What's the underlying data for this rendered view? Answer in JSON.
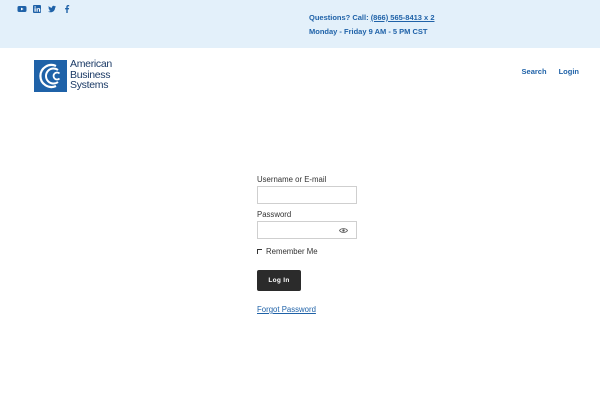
{
  "topbar": {
    "social": [
      "youtube-icon",
      "linkedin-icon",
      "twitter-icon",
      "facebook-icon"
    ],
    "questions_label": "Questions? Call:",
    "phone": "(866) 565-8413 x 2",
    "hours": "Monday - Friday 9 AM - 5 PM CST"
  },
  "logo": {
    "line1": "American",
    "line2": "Business",
    "line3": "Systems",
    "color": "#1f62a8"
  },
  "nav": {
    "search": "Search",
    "login": "Login"
  },
  "form": {
    "username_label": "Username or E-mail",
    "username_value": "",
    "password_label": "Password",
    "password_value": "",
    "remember_label": "Remember Me",
    "login_button": "Log In",
    "forgot_link": "Forgot Password"
  },
  "colors": {
    "topbar_bg": "#e3f0fa",
    "accent": "#1f62a8",
    "button_bg": "#2b2b2b"
  }
}
